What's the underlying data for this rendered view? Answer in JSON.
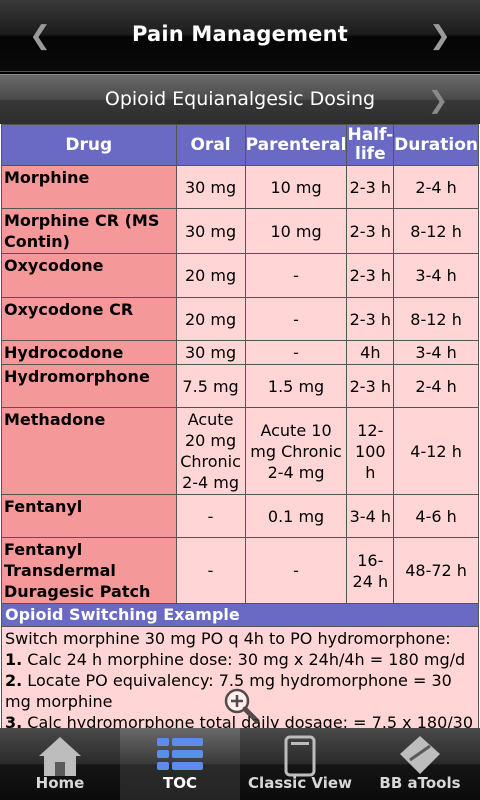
{
  "header": {
    "title": "Pain Management"
  },
  "subheader": {
    "title": "Opioid Equianalgesic Dosing"
  },
  "table": {
    "columns": [
      "Drug",
      "Oral",
      "Parenteral",
      "Half-life",
      "Duration"
    ],
    "rows": [
      {
        "drug": "Morphine",
        "oral": "30 mg",
        "parenteral": "10 mg",
        "half_life": "2-3 h",
        "duration": "2-4 h"
      },
      {
        "drug": "Morphine CR (MS Contin)",
        "oral": "30 mg",
        "parenteral": "10 mg",
        "half_life": "2-3 h",
        "duration": "8-12 h"
      },
      {
        "drug": "Oxycodone",
        "oral": "20 mg",
        "parenteral": "-",
        "half_life": "2-3 h",
        "duration": "3-4 h"
      },
      {
        "drug": "Oxycodone CR",
        "oral": "20 mg",
        "parenteral": "-",
        "half_life": "2-3 h",
        "duration": "8-12 h"
      },
      {
        "drug": "Hydrocodone",
        "oral": "30 mg",
        "parenteral": "-",
        "half_life": "4h",
        "duration": "3-4 h"
      },
      {
        "drug": "Hydromorphone",
        "oral": "7.5 mg",
        "parenteral": "1.5 mg",
        "half_life": "2-3 h",
        "duration": "2-4 h"
      },
      {
        "drug": "Methadone",
        "oral": "Acute 20 mg Chronic 2-4 mg",
        "parenteral": "Acute 10 mg Chronic 2-4 mg",
        "half_life": "12-100 h",
        "duration": "4-12 h"
      },
      {
        "drug": "Fentanyl",
        "oral": "-",
        "parenteral": "0.1 mg",
        "half_life": "3-4 h",
        "duration": "4-6 h"
      },
      {
        "drug": "Fentanyl Transdermal Duragesic Patch",
        "oral": "-",
        "parenteral": "-",
        "half_life": "16-24 h",
        "duration": "48-72 h"
      }
    ]
  },
  "example": {
    "title": "Opioid Switching Example",
    "intro": "Switch morphine 30 mg PO q 4h to PO hydromorphone:",
    "steps": [
      {
        "num": "1.",
        "text": " Calc 24 h morphine dose: 30 mg x 24h/4h = 180 mg/d"
      },
      {
        "num": "2.",
        "text": " Locate PO equivalency: 7.5 mg hydromorphone = 30 mg morphine"
      },
      {
        "num": "3.",
        "text": " Calc hydromorphone total daily dosage: = 7.5 x 180/30"
      }
    ]
  },
  "tabs": [
    {
      "label": "Home",
      "icon": "home-icon",
      "active": false
    },
    {
      "label": "TOC",
      "icon": "list-icon",
      "active": true
    },
    {
      "label": "Classic View",
      "icon": "page-icon",
      "active": false
    },
    {
      "label": "BB aTools",
      "icon": "tools-icon",
      "active": false
    }
  ]
}
